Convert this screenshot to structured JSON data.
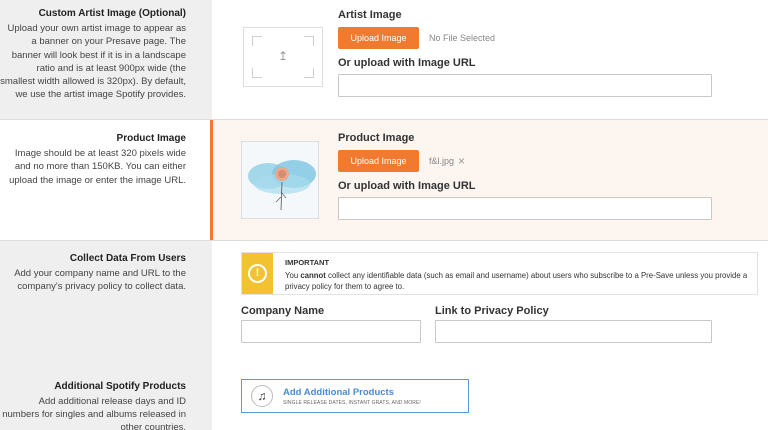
{
  "custom_artist": {
    "title": "Custom Artist Image (Optional)",
    "description": "Upload your own artist image to appear as a banner on your Presave page. The banner will look best if it is in a landscape ratio and is at least 900px wide (the smallest width allowed is 320px). By default, we use the artist image Spotify provides.",
    "field_label": "Artist Image",
    "upload_button": "Upload Image",
    "file_status": "No File Selected",
    "url_label": "Or upload with Image URL",
    "url_value": ""
  },
  "product_image": {
    "title": "Product Image",
    "description": "Image should be at least 320 pixels wide and no more than 150KB. You can either upload the image or enter the image URL.",
    "field_label": "Product Image",
    "upload_button": "Upload Image",
    "file_name": "f&l.jpg",
    "remove_glyph": "×",
    "url_label": "Or upload with Image URL",
    "url_value": ""
  },
  "collect_data": {
    "title": "Collect Data From Users",
    "description": "Add your company name and URL to the company's privacy policy to collect data.",
    "notice_title": "IMPORTANT",
    "notice_pre": "You ",
    "notice_bold": "cannot",
    "notice_post": " collect any identifiable data (such as email and username) about users who subscribe to a Pre-Save unless you provide a privacy policy for them to agree to.",
    "notice_icon": "!",
    "company_label": "Company Name",
    "company_value": "",
    "privacy_label": "Link to Privacy Policy",
    "privacy_value": ""
  },
  "additional_products": {
    "title": "Additional Spotify Products",
    "description": "Add additional release days and ID numbers for singles and albums released in other countries.",
    "button_title": "Add Additional Products",
    "button_subtitle": "SINGLE RELEASE DATES, INSTANT GRATS, AND MORE!",
    "button_icon": "♫"
  },
  "colors": {
    "accent": "#f07b30",
    "warning": "#f2c230",
    "link": "#4a8cd0"
  }
}
